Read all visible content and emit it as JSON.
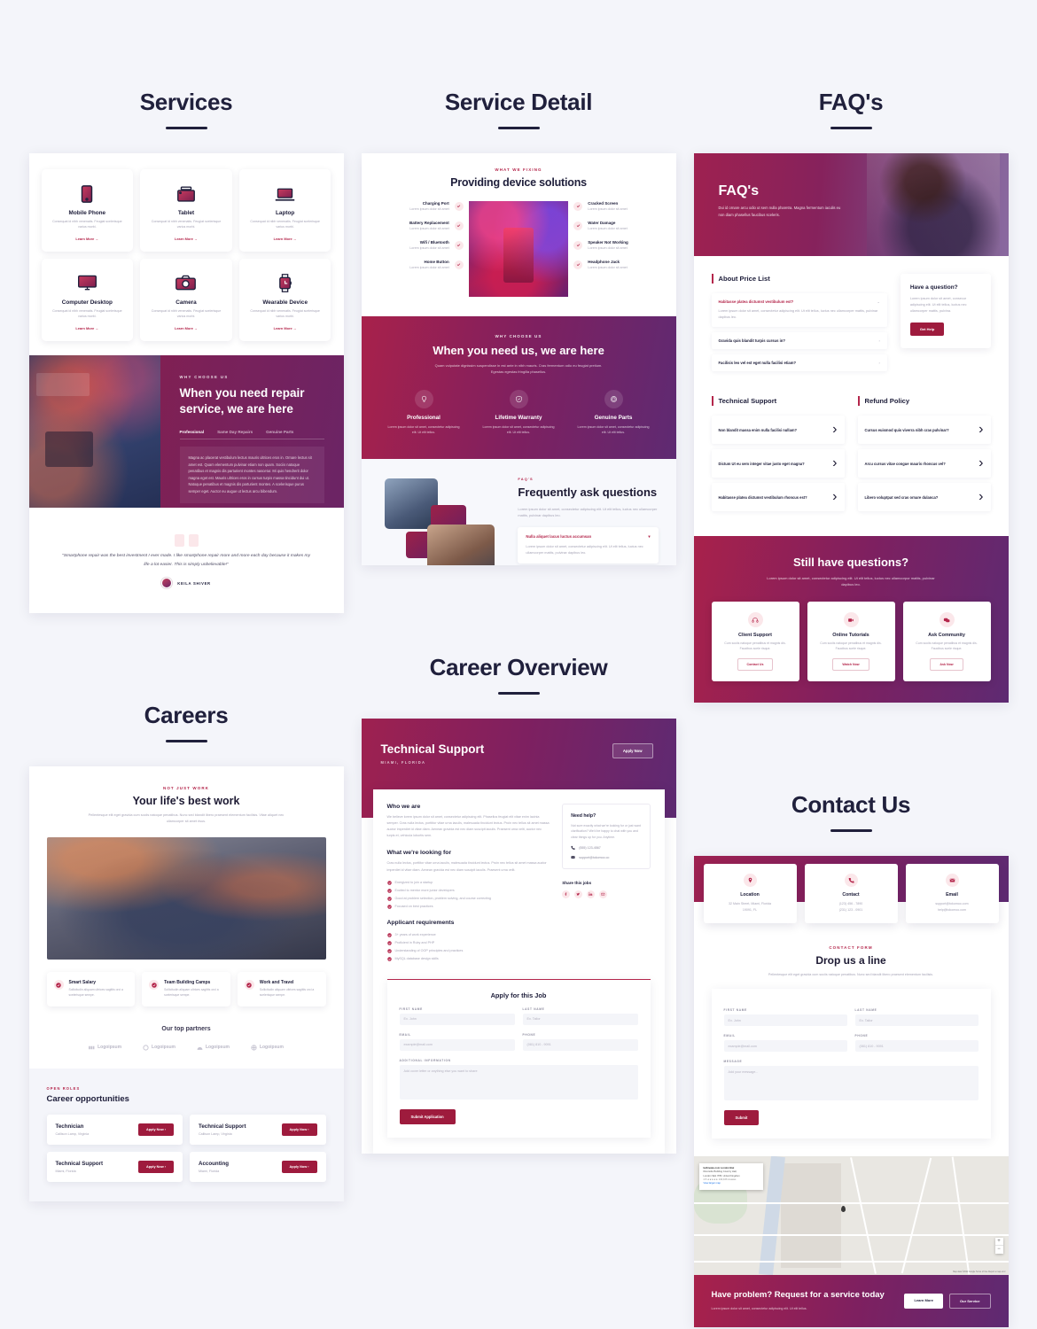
{
  "pages": {
    "services": {
      "title": "Services"
    },
    "service_detail": {
      "title": "Service Detail"
    },
    "faqs": {
      "title": "FAQ's"
    },
    "careers": {
      "title": "Careers"
    },
    "career_overview": {
      "title": "Career Overview"
    },
    "contact": {
      "title": "Contact Us"
    }
  },
  "services": {
    "cards": [
      {
        "name": "Mobile Phone",
        "desc": "Consequat id nibh venenatis. Feugiat scelerisque varius morbi.",
        "link": "Learn More"
      },
      {
        "name": "Tablet",
        "desc": "Consequat id nibh venenatis. Feugiat scelerisque varius morbi.",
        "link": "Learn More"
      },
      {
        "name": "Laptop",
        "desc": "Consequat id nibh venenatis. Feugiat scelerisque varius morbi.",
        "link": "Learn More"
      },
      {
        "name": "Computer Desktop",
        "desc": "Consequat id nibh venenatis. Feugiat scelerisque varius morbi.",
        "link": "Learn More"
      },
      {
        "name": "Camera",
        "desc": "Consequat id nibh venenatis. Feugiat scelerisque varius morbi.",
        "link": "Learn More"
      },
      {
        "name": "Wearable Device",
        "desc": "Consequat id nibh venenatis. Feugiat scelerisque varius morbi.",
        "link": "Learn More"
      }
    ],
    "why": {
      "eyebrow": "WHY CHOOSE US",
      "heading": "When you need repair service, we are here",
      "tabs": [
        "Professional",
        "Same Day Repairs",
        "Genuine Parts"
      ],
      "body": "Magna ac placerat vestibulum lectus mauris ultrices eros in. Ornare lectus sit amet est. Quam elementum pulvinar etiam non quam. Sociis natoque penatibus et magnis dis parturient montes nascetur. Mi quis hendrerit dolor magna eget est. Mauris ultrices eros in cursus turpis massa tincidunt dui ut. Natoque penatibus et magnis dis parturient montes. A scelerisque purus semper eget. Auctor eu augue ut lectus arcu bibendum."
    },
    "quote": {
      "text": "\"Smartphone repair was the best investment I ever made. I like smartphone repair more and more each day because it makes my life a lot easier. This is simply unbelievable!\"",
      "author": "KEILA SHIVER"
    }
  },
  "service_detail": {
    "eyebrow": "WHAT WE FIXING",
    "heading": "Providing device solutions",
    "left_items": [
      {
        "title": "Charging Port",
        "desc": "Lorem ipsum dolor sit amet"
      },
      {
        "title": "Battery Replacement",
        "desc": "Lorem ipsum dolor sit amet"
      },
      {
        "title": "Wifi / Bluetooth",
        "desc": "Lorem ipsum dolor sit amet"
      },
      {
        "title": "Home Button",
        "desc": "Lorem ipsum dolor sit amet"
      }
    ],
    "right_items": [
      {
        "title": "Cracked Screen",
        "desc": "Lorem ipsum dolor sit amet"
      },
      {
        "title": "Water Damage",
        "desc": "Lorem ipsum dolor sit amet"
      },
      {
        "title": "Speaker Not Working",
        "desc": "Lorem ipsum dolor sit amet"
      },
      {
        "title": "Headphone Jack",
        "desc": "Lorem ipsum dolor sit amet"
      }
    ],
    "why": {
      "eyebrow": "WHY CHOOSE US",
      "heading": "When you need us, we are here",
      "lead": "Quam vulputate dignissim suspendisse in est ante in nibh mauris. Cras fermentum odio eu feugiat pretium. Egestas egestas fringilla phasellus.",
      "features": [
        {
          "title": "Professional",
          "desc": "Lorem ipsum dolor sit amet, consectetur adipiscing elit. Ut elit tellus."
        },
        {
          "title": "Lifetime Warranty",
          "desc": "Lorem ipsum dolor sit amet, consectetur adipiscing elit. Ut elit tellus."
        },
        {
          "title": "Genuine Parts",
          "desc": "Lorem ipsum dolor sit amet, consectetur adipiscing elit. Ut elit tellus."
        }
      ]
    },
    "faq": {
      "eyebrow": "FAQ'S",
      "heading": "Frequently ask questions",
      "lead": "Lorem ipsum dolor sit amet, consectetur adipiscing elit. Ut elit tellus, luctus nec ullamcorper mattis, pulvinar dapibus leo.",
      "question": "Nulla aliquet lacus luctus accumsan",
      "answer": "Lorem ipsum dolor sit amet, consectetur adipiscing elit. Ut elit tellus, luctus nec ullamcorper mattis, pulvinar dapibus leo."
    }
  },
  "faqs": {
    "hero": {
      "title": "FAQ's",
      "subtitle": "Dui id ornare arcu odio ut sem nulla pharetra. Magna fermentum iaculis eu non diam phasellus faucibus sceleris."
    },
    "price_list": {
      "title": "About Price List",
      "items": [
        {
          "q": "Habitasse platea dictumst vestibulum est?",
          "a": "Lorem ipsum dolor sit amet, consectetur adipiscing elit. Ut elit tellus, luctus nec ullamcorper mattis, pulvinar dapibus leo.",
          "open": true
        },
        {
          "q": "Gravida quis blandit turpis cursus in?",
          "open": false
        },
        {
          "q": "Facilisis leo vel est eget nulla facilisi etiam?",
          "open": false
        }
      ]
    },
    "help": {
      "title": "Have a question?",
      "body": "Lorem ipsum dolor sit amet, consecur adipiscing elit. Ut elit tellus, luctus nec ullamcorper mattis, pulvina.",
      "button": "Get Help"
    },
    "technical_support": {
      "title": "Technical Support",
      "items": [
        "Non blandit massa enim nulla facilisi nullam?",
        "Dictum Ut eu sem integer vitae justo eget magna?",
        "Habitasse platea dictumst vestibulum rhoncus est?"
      ]
    },
    "refund_policy": {
      "title": "Refund Policy",
      "items": [
        "Cursus euismod quis viverra nibh cras pulvinar?",
        "Arcu cursus vitae congue mauris rhoncus vel?",
        "Libero voluptpat sed cras ornare dulanca?"
      ]
    },
    "still": {
      "heading": "Still have questions?",
      "lead": "Lorem ipsum dolor sit amet, consectetur adipiscing elit. Ut elit tellus, luctus nec ullamcorpor mattis, pulvinar dapibus leo.",
      "cards": [
        {
          "title": "Client Support",
          "desc": "Cum sociis natoque penatibus et magnis dis. Faucibus scele risque.",
          "button": "Contact Us",
          "icon": "headset-icon"
        },
        {
          "title": "Online Tutorials",
          "desc": "Cum sociis natoque penatibus et magnis dis. Faucibus scele risque.",
          "button": "Watch Now",
          "icon": "video-icon"
        },
        {
          "title": "Ask Community",
          "desc": "Cum sociis natoque penatibus et magnis dis. Faucibus scele risque.",
          "button": "Ask Now",
          "icon": "chat-icon"
        }
      ]
    }
  },
  "careers": {
    "eyebrow": "NOT JUST WORK",
    "heading": "Your life's best work",
    "lead": "Pellentesque elit eget gravida cum sociis natoque penatibus. Nunc sed blandit libero praesent elementum facilisis. Vitae aliquet nec ullamcorper sit amet risus.",
    "perks": [
      {
        "title": "Smart Salary",
        "desc": "Sollicitudin aliquam ultrices sagittis orci a scelerisque sempe."
      },
      {
        "title": "Team Building Camps",
        "desc": "Sollicitudin aliquam ultrices sagittis orci a scelerisque sempe."
      },
      {
        "title": "Work and Travel",
        "desc": "Sollicitudin aliquam ultrices sagittis orci a scelerisque sempe."
      }
    ],
    "partners_title": "Our top partners",
    "partners": [
      "Logoipsum",
      "Logoipsum",
      "Logoipsum",
      "Logoipsum"
    ],
    "open_roles_eyebrow": "OPEN ROLES",
    "open_roles_title": "Career opportunities",
    "roles": [
      {
        "title": "Technician",
        "location": "Callison Lamp, Virginia",
        "button": "Apply Now"
      },
      {
        "title": "Technical Support",
        "location": "Callison Lamp, Virginia",
        "button": "Apply Now"
      },
      {
        "title": "Technical Support",
        "location": "Miami, Florida",
        "button": "Apply Now"
      },
      {
        "title": "Accounting",
        "location": "Miami, Florida",
        "button": "Apply Now"
      }
    ]
  },
  "career_overview": {
    "job_title": "Technical Support",
    "job_location": "MIAMI, FLORIDA",
    "apply_button": "Apply Now",
    "who_we_are": {
      "title": "Who we are",
      "body": "We believe lorem ipsum dolor sit amet, consectetur adipiscing elit. Phasellus feugiat elit vitae enim lacinia semper. Cras nulla lectus, porttitor vitae urna iaculis, malesuada tincidunt lectus. Proin nec tellus sit amet massa auctor imperdiet id vitae diam. Aenean gravida est nec diam suscipit iaculis. Praesent urna velit, auctor nec turpis et, vehicula lobortis sem."
    },
    "looking_for": {
      "title": "What we're looking for",
      "body": "Cras nulla lectus, porttitor vitae urna iaculis, malesuada tincidunt lectus. Proin nec tellus sit amet massa auctor imperdiet id vitae diam. Aenean gravida est nec diam suscipit iaculis. Praesent urna velit.",
      "items": [
        "Energized to join a startup",
        "Excited to mentor more junior developers",
        "Good at problem selection, problem solving, and course correcting",
        "Focused on best practices"
      ]
    },
    "requirements": {
      "title": "Applicant requirements",
      "items": [
        "3+ years of work experience",
        "Proficient in Ruby and PHP",
        "Understanding of OOP principles and practices",
        "MySQL database design skills"
      ]
    },
    "need_help": {
      "title": "Need help?",
      "body": "Not sure exactly what we're looking for or just want clarification? We'd be happy to chat with you and clear things up for you. Anytime.",
      "phone": "(555) 123-4567",
      "email": "support@tokomoo.co"
    },
    "share": {
      "title": "Share this jobs",
      "icons": [
        "facebook-icon",
        "twitter-icon",
        "linkedin-icon",
        "mail-icon"
      ]
    },
    "form": {
      "title": "Apply for this Job",
      "first_name_label": "FIRST NAME",
      "first_name_placeholder": "Ex. John",
      "last_name_label": "LAST NAME",
      "last_name_placeholder": "Ex. Tailor",
      "email_label": "EMAIL",
      "email_placeholder": "example@mail.com",
      "phone_label": "PHONE",
      "phone_placeholder": "(081) 810 - 9091",
      "additional_label": "ADDITIONAL INFORMATION",
      "additional_placeholder": "Add cover letter or anything else you want to share",
      "submit": "Submit Application"
    }
  },
  "contact": {
    "cards": [
      {
        "title": "Location",
        "lines": [
          "32 Main Street, Miami, Florida",
          "19091, FL"
        ],
        "icon": "pin-icon"
      },
      {
        "title": "Contact",
        "lines": [
          "(123) 456 - 7890",
          "(231) 123 - 0901"
        ],
        "icon": "phone-icon"
      },
      {
        "title": "Email",
        "lines": [
          "support@tokomoo.com",
          "help@tokomoo.com"
        ],
        "icon": "mail-icon"
      }
    ],
    "form_eyebrow": "CONTACT FORM",
    "form_heading": "Drop us a line",
    "form_lead": "Pellentesque elit eget gravida cum sociis natoque penatibus. Nunc sed blandit libero praesent elementum facilisis.",
    "form": {
      "first_name_label": "FIRST NAME",
      "first_name_placeholder": "Ex. John",
      "last_name_label": "LAST NAME",
      "last_name_placeholder": "Ex. Tailor",
      "email_label": "EMAIL",
      "email_placeholder": "example@mail.com",
      "phone_label": "PHONE",
      "phone_placeholder": "(081) 810 - 9091",
      "message_label": "MESSAGE",
      "message_placeholder": "Add your message...",
      "submit": "Submit"
    },
    "map": {
      "card_title": "bellmeate.com London Bwi",
      "card_lines": [
        "Riverside Building Country Hall,",
        "London SE1 7PB, United Kingdom"
      ],
      "rating": "4.5 ★★★★★   130,106 reviews",
      "view_larger": "View larger map",
      "directions": "Directions",
      "zoom_in": "+",
      "zoom_out": "−",
      "attribution": "Map data ©2022 Google   Terms of Use   Report a map error"
    },
    "footer": {
      "heading": "Have problem? Request for a service today",
      "lead": "Lorem ipsum dolor sit amet, consectetur adipiscing elit. Ut elit tellus.",
      "btn_primary": "Learn More",
      "btn_secondary": "Our Service"
    }
  },
  "colors": {
    "accent": "#9e1b3d",
    "accent_light": "#b4264b",
    "dark": "#20203c",
    "bg": "#f4f5fa"
  }
}
